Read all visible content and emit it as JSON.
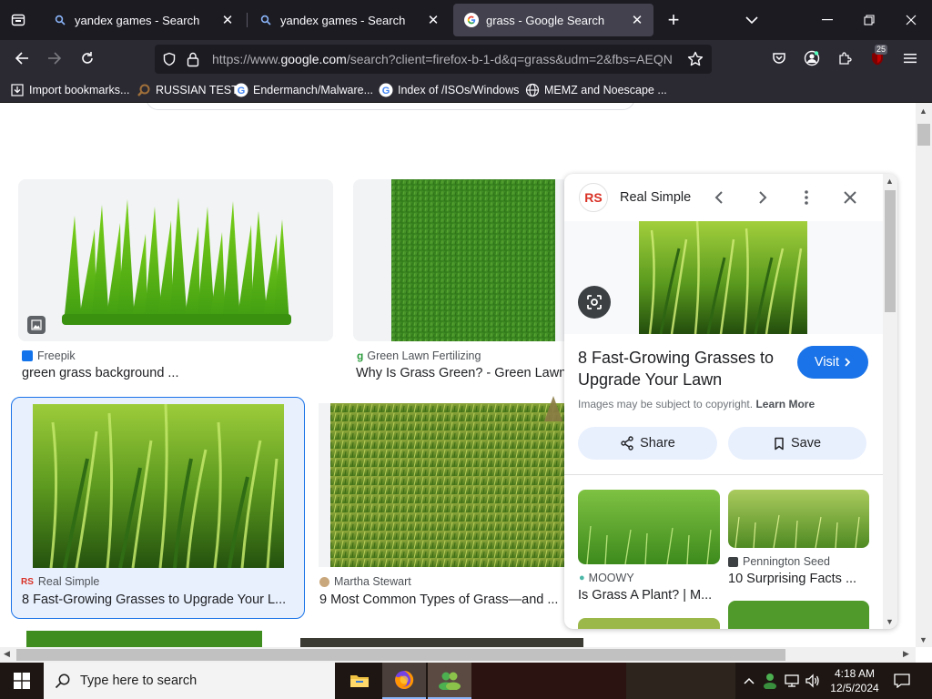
{
  "browser": {
    "tabs": [
      {
        "title": "yandex games - Search",
        "icon": "search-icon",
        "active": false
      },
      {
        "title": "yandex games - Search",
        "icon": "search-icon",
        "active": false
      },
      {
        "title": "grass - Google Search",
        "icon": "google-g-icon",
        "active": true
      }
    ],
    "url": {
      "prefix": "https://www.",
      "domain": "google.com",
      "rest": "/search?client=firefox-b-1-d&q=grass&udm=2&fbs=AEQN"
    },
    "extension_badge": "25",
    "bookmarks": [
      {
        "label": "Import bookmarks...",
        "icon": "import-icon"
      },
      {
        "label": "RUSSIAN TEST",
        "icon": "magnifier-icon"
      },
      {
        "label": "Endermanch/Malware...",
        "icon": "google-g-icon"
      },
      {
        "label": "Index of /ISOs/Windows",
        "icon": "google-g-icon"
      },
      {
        "label": "MEMZ and Noescape ...",
        "icon": "globe-icon"
      }
    ]
  },
  "results": [
    {
      "source": "Freepik",
      "title": "green grass background ...",
      "selected": false
    },
    {
      "source": "Green Lawn Fertilizing",
      "title": "Why Is Grass Green? - Green Lawn",
      "selected": false
    },
    {
      "source": "Real Simple",
      "title": "8 Fast-Growing Grasses to Upgrade Your L...",
      "selected": true
    },
    {
      "source": "Martha Stewart",
      "title": "9 Most Common Types of Grass—and ...",
      "selected": false
    }
  ],
  "panel": {
    "source_logo": "RS",
    "source_name": "Real Simple",
    "title": "8 Fast-Growing Grasses to Upgrade Your Lawn",
    "visit_label": "Visit",
    "copyright_text": "Images may be subject to copyright.",
    "learn_more": "Learn More",
    "share_label": "Share",
    "save_label": "Save",
    "related": [
      {
        "source": "MOOWY",
        "title": "Is Grass A Plant? | M..."
      },
      {
        "source": "Pennington Seed",
        "title": "10 Surprising Facts ..."
      }
    ]
  },
  "taskbar": {
    "search_placeholder": "Type here to search",
    "time": "4:18 AM",
    "date": "12/5/2024"
  },
  "colors": {
    "accent_blue": "#1a73e8",
    "selected_bg": "#e8f0fe",
    "real_simple_red": "#d93025",
    "tab_active": "#42414d",
    "chrome_dark": "#1c1b22"
  }
}
